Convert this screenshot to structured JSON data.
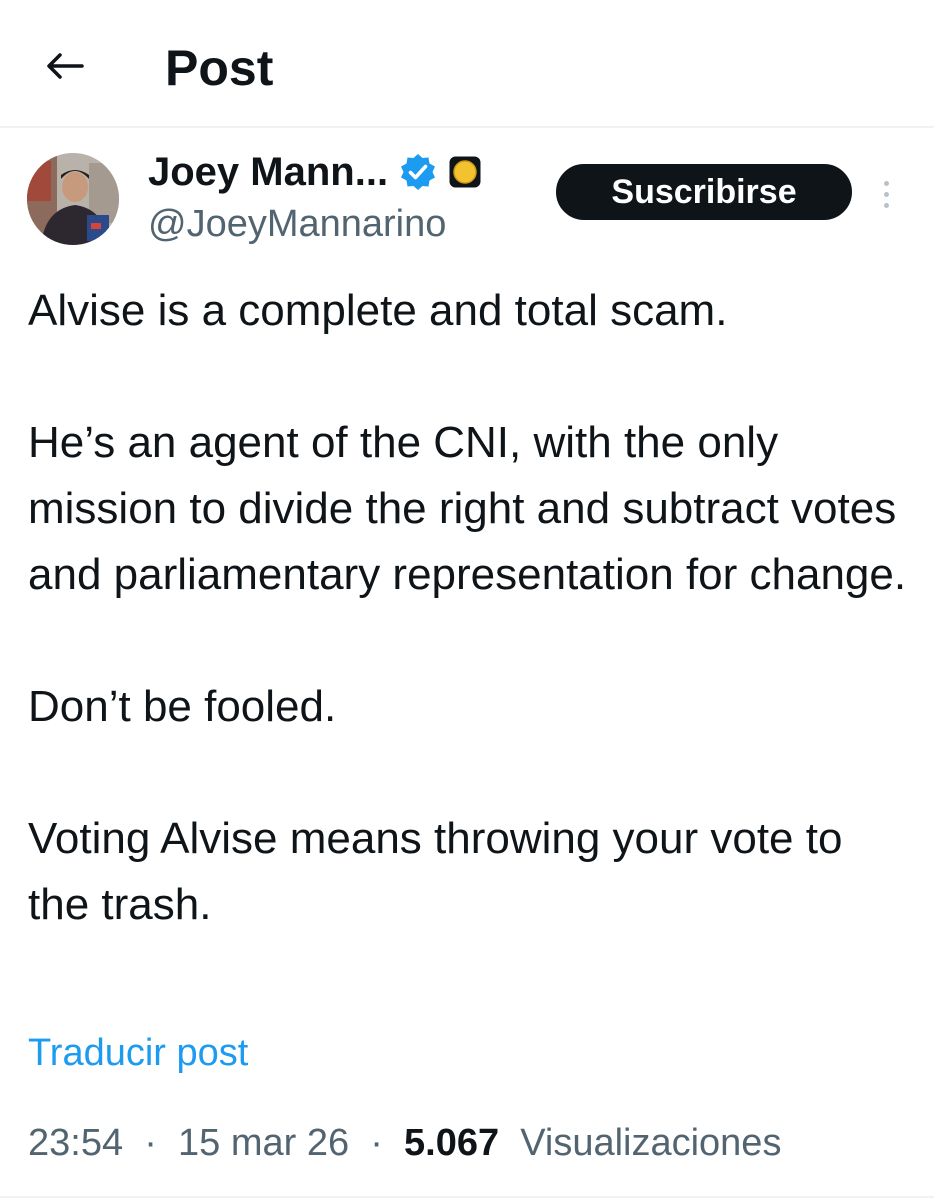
{
  "header": {
    "title": "Post",
    "back_icon": "arrow-left-icon"
  },
  "author": {
    "display_name": "Joey Mann...",
    "handle": "@JoeyMannarino",
    "verified_icon": "verified-badge-icon",
    "affiliate_icon": "affiliate-badge-icon",
    "verified_color": "#1d9bf0"
  },
  "actions": {
    "subscribe_label": "Suscribirse",
    "more_icon": "more-vertical-icon"
  },
  "post": {
    "paragraphs": [
      "Alvise is a complete and total scam.",
      "He’s an agent of the CNI, with the only mission to divide the right and subtract votes and parliamentary representation for change.",
      "Don’t be fooled.",
      "Voting Alvise means throwing your vote to the trash."
    ],
    "translate_label": "Traducir post"
  },
  "meta": {
    "time": "23:54",
    "separator": "·",
    "date": "15 mar 26",
    "views_count": "5.067",
    "views_label": "Visualizaciones"
  },
  "colors": {
    "accent": "#1d9bf0",
    "text": "#0f1419",
    "secondary_text": "#536471"
  }
}
